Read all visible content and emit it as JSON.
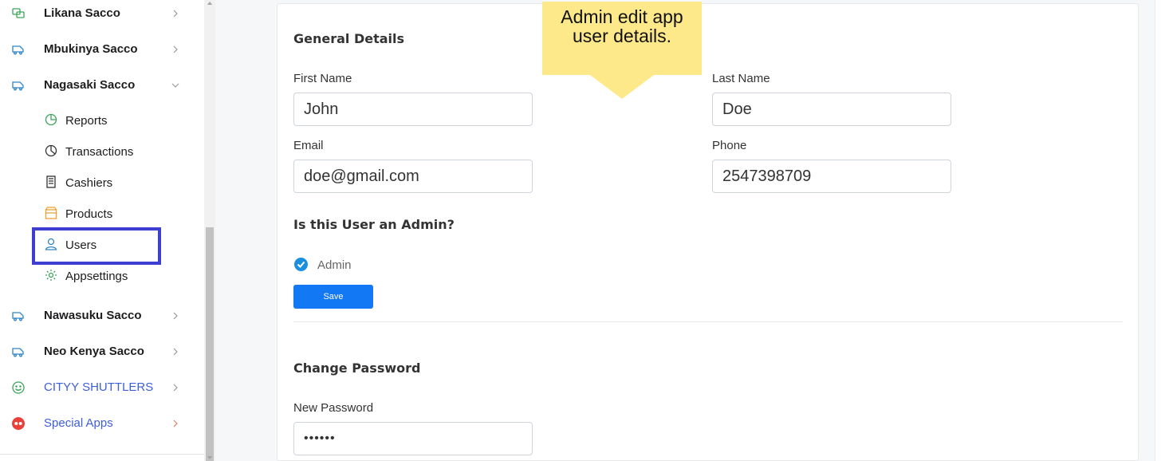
{
  "sidebar": {
    "saccos": [
      {
        "label": "Likana Sacco"
      },
      {
        "label": "Mbukinya Sacco"
      },
      {
        "label": "Nagasaki Sacco"
      },
      {
        "label": "Nawasuku Sacco"
      },
      {
        "label": "Neo Kenya Sacco"
      },
      {
        "label": "CITYY SHUTTLERS"
      },
      {
        "label": "Special Apps"
      }
    ],
    "submenu": [
      {
        "label": "Reports"
      },
      {
        "label": "Transactions"
      },
      {
        "label": "Cashiers"
      },
      {
        "label": "Products"
      },
      {
        "label": "Users"
      },
      {
        "label": "Appsettings"
      }
    ]
  },
  "callout": {
    "line1": "Admin edit app",
    "line2": "user details."
  },
  "general": {
    "title": "General Details",
    "first_name_label": "First Name",
    "first_name_value": "John",
    "last_name_label": "Last Name",
    "last_name_value": "Doe",
    "email_label": "Email",
    "email_value": "doe@gmail.com",
    "phone_label": "Phone",
    "phone_value": "2547398709"
  },
  "admin": {
    "title": "Is this User an Admin?",
    "option_label": "Admin",
    "checked": true,
    "save_label": "Save"
  },
  "password": {
    "title": "Change Password",
    "new_password_label": "New Password",
    "new_password_value": "••••••"
  },
  "colors": {
    "accent": "#1378f3",
    "highlight_box": "#3e3fd1",
    "callout": "#fde98a",
    "link": "#3d5fd9"
  }
}
